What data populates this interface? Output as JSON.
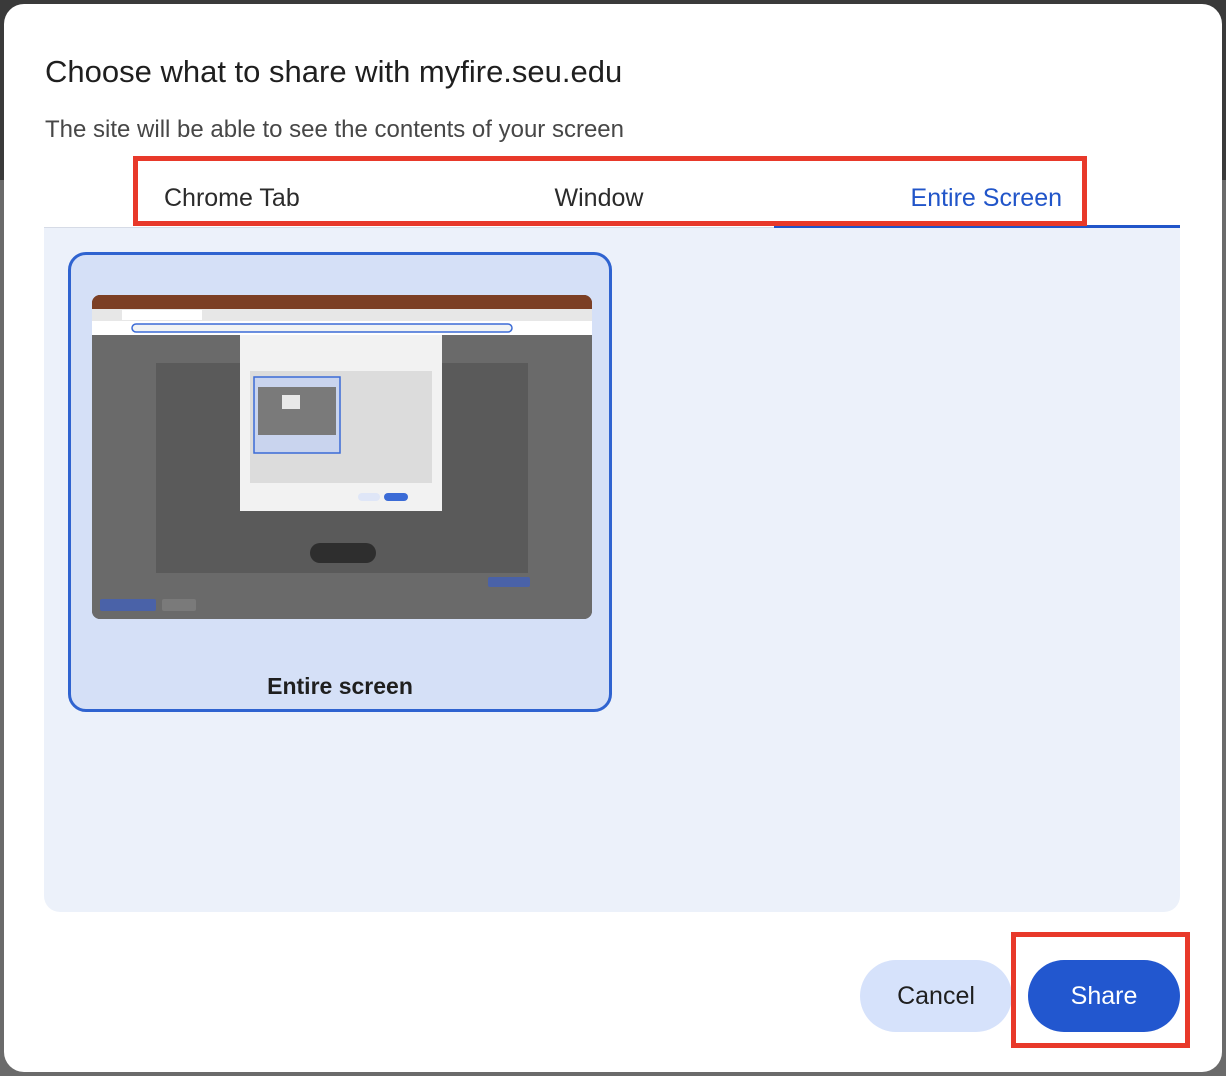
{
  "dialog": {
    "title": "Choose what to share with myfire.seu.edu",
    "subtitle": "The site will be able to see the contents of your screen"
  },
  "tabs": [
    {
      "label": "Chrome Tab",
      "selected": false
    },
    {
      "label": "Window",
      "selected": false
    },
    {
      "label": "Entire Screen",
      "selected": true
    }
  ],
  "source": {
    "label": "Entire screen",
    "selected": true
  },
  "buttons": {
    "cancel_label": "Cancel",
    "share_label": "Share"
  },
  "colors": {
    "accent": "#2257cf",
    "highlight": "#e8392a",
    "panel_bg": "#ecf1fa",
    "card_bg": "#d5e0f7"
  }
}
